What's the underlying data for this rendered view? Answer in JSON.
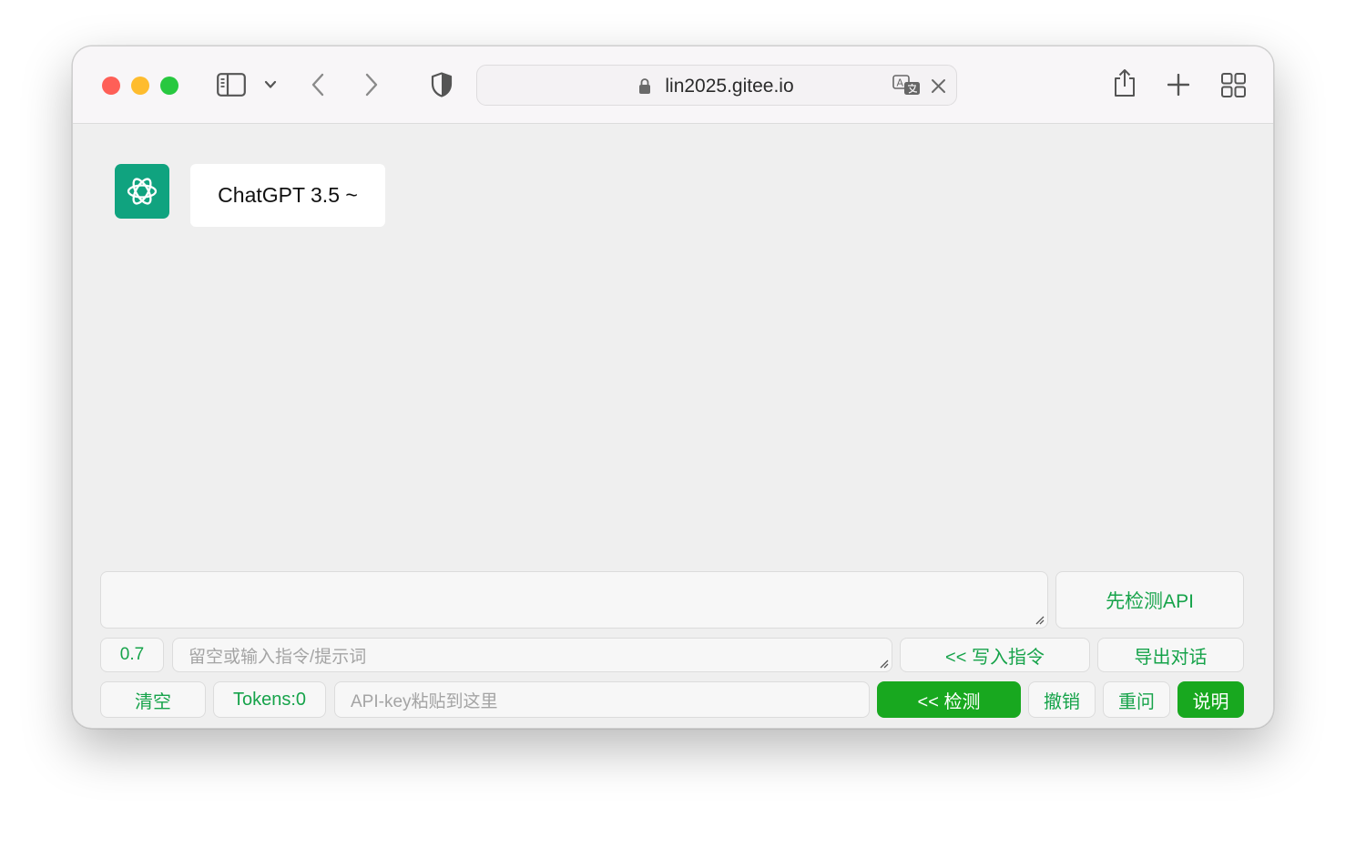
{
  "browser": {
    "url": "lin2025.gitee.io",
    "icons": {
      "sidebar": "sidebar-icon",
      "chevron": "chevron-down-icon",
      "back": "back-icon",
      "forward": "forward-icon",
      "shield": "privacy-shield-icon",
      "lock": "lock-icon",
      "translate": "translate-icon",
      "close": "close-icon",
      "share": "share-icon",
      "new_tab": "plus-icon",
      "tabs": "tab-overview-icon"
    }
  },
  "chat": {
    "bot_name": "ChatGPT 3.5 ~",
    "avatar_icon": "openai-logo-icon"
  },
  "controls": {
    "check_api_label": "先检测API",
    "temperature": "0.7",
    "prompt_placeholder": "留空或输入指令/提示词",
    "write_prompt_label": "<< 写入指令",
    "export_label": "导出对话",
    "clear_label": "清空",
    "tokens_label": "Tokens:0",
    "apikey_placeholder": "API-key粘贴到这里",
    "detect_label": "<< 检测",
    "undo_label": "撤销",
    "retry_label": "重问",
    "help_label": "说明"
  },
  "colors": {
    "accent_green": "#18a81f",
    "text_green": "#16a34a",
    "avatar_teal": "#10a37f"
  }
}
